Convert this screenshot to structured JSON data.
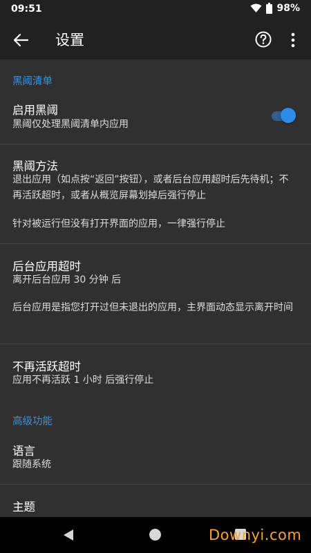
{
  "status": {
    "time": "09:51",
    "battery": "98%"
  },
  "appbar": {
    "title": "设置"
  },
  "sections": {
    "blacklist_header": "黑阈清单",
    "advanced_header": "高级功能"
  },
  "items": {
    "enable": {
      "title": "启用黑阈",
      "summary": "黑阈仅处理黑阈清单内应用",
      "toggle_on": true
    },
    "method": {
      "title": "黑阈方法",
      "summary": "退出应用（如点按“返回”按钮），或者后台应用超时后先待机；不再活跃超时，或者从概览屏幕划掉后强行停止",
      "note": "针对被运行但没有打开界面的应用，一律强行停止"
    },
    "bg_timeout": {
      "title": "后台应用超时",
      "summary": "离开后台应用 30 分钟 后",
      "note": "后台应用是指您打开过但未退出的应用，主界面动态显示离开时间"
    },
    "inactive_timeout": {
      "title": "不再活跃超时",
      "summary": "应用不再活跃 1 小时 后强行停止"
    },
    "language": {
      "title": "语言",
      "summary": "跟随系统"
    },
    "theme": {
      "title": "主题"
    }
  },
  "watermark": "Downyi.com",
  "colors": {
    "accent": "#3d8fe0",
    "background": "#303030",
    "toolbar": "#212121",
    "watermark": "#f2a43a"
  }
}
